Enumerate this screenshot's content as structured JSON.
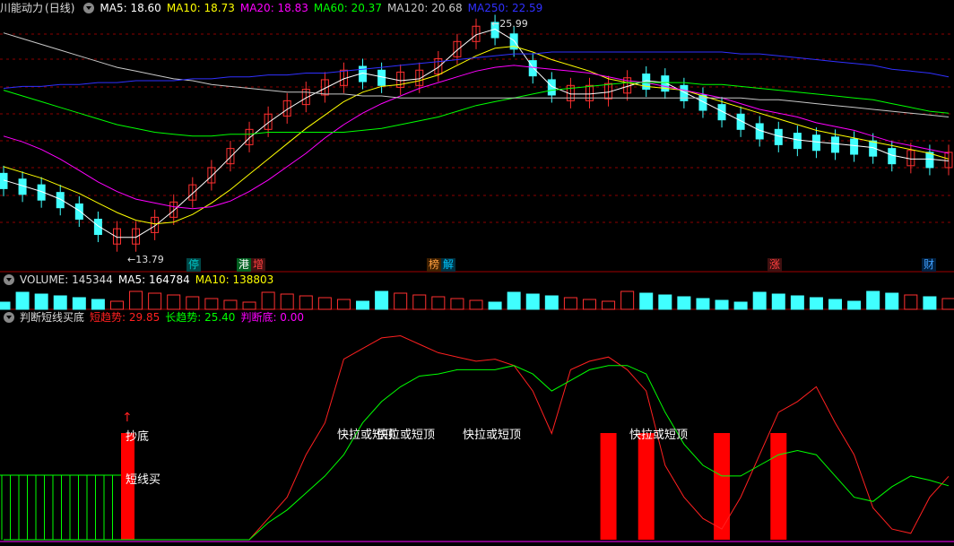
{
  "title": "川能动力",
  "period": "(日线)",
  "ma_header": [
    {
      "label": "MA5: 18.60",
      "color": "#ffffff"
    },
    {
      "label": "MA10: 18.73",
      "color": "#ffff00"
    },
    {
      "label": "MA20: 18.83",
      "color": "#ff00ff"
    },
    {
      "label": "MA60: 20.37",
      "color": "#00ff00"
    },
    {
      "label": "MA120: 20.68",
      "color": "#c8c8c8"
    },
    {
      "label": "MA250: 22.59",
      "color": "#3030ff"
    }
  ],
  "price_high_label": "25.99",
  "price_low_label": "13.79",
  "event_tags": [
    {
      "text": "停",
      "color": "#00c8c8",
      "bg": "#004848"
    },
    {
      "text": "港",
      "color": "#ffffff",
      "bg": "#006020"
    },
    {
      "text": "增",
      "color": "#ff4040",
      "bg": "#401010"
    },
    {
      "text": "榜",
      "color": "#ffa040",
      "bg": "#402000"
    },
    {
      "text": "解",
      "color": "#00c8ff",
      "bg": "#003040"
    },
    {
      "text": "涨",
      "color": "#ff4040",
      "bg": "#401010"
    },
    {
      "text": "财",
      "color": "#40a0ff",
      "bg": "#002040"
    }
  ],
  "volume_header": [
    {
      "label": "VOLUME: 145344",
      "color": "#dddddd"
    },
    {
      "label": "MA5: 164784",
      "color": "#ffffff"
    },
    {
      "label": "MA10: 138803",
      "color": "#ffff00"
    }
  ],
  "indicator_header": [
    {
      "label": "判断短线买底",
      "color": "#dddddd"
    },
    {
      "label": "短趋势: 29.85",
      "color": "#ff2020"
    },
    {
      "label": "长趋势: 25.40",
      "color": "#00ff00"
    },
    {
      "label": "判断底: 0.00",
      "color": "#ff00ff"
    }
  ],
  "indicator_annotations": [
    {
      "text": "抄底"
    },
    {
      "text": "短线买"
    },
    {
      "text": "快拉或短顶"
    },
    {
      "text": "快拉或短顶"
    },
    {
      "text": "快拉或短顶"
    },
    {
      "text": "快拉或短顶"
    }
  ],
  "colors": {
    "up": "#ff3030",
    "down": "#40ffff",
    "grid": "#8b0000"
  },
  "chart_data": {
    "type": "candlestick",
    "price_range": [
      13.79,
      25.99
    ],
    "ma_lines": [
      {
        "name": "MA5",
        "color": "#ffffff",
        "values": [
          17.6,
          17.3,
          17.0,
          16.6,
          16.0,
          15.2,
          14.6,
          14.6,
          15.2,
          16.0,
          16.9,
          17.8,
          18.8,
          19.8,
          20.6,
          21.3,
          21.9,
          22.4,
          22.9,
          23.2,
          23.0,
          22.8,
          22.9,
          23.5,
          24.4,
          25.2,
          25.5,
          24.9,
          23.5,
          22.5,
          22.1,
          22.1,
          22.2,
          22.5,
          22.8,
          22.7,
          22.2,
          21.7,
          21.2,
          20.7,
          20.2,
          19.9,
          19.7,
          19.6,
          19.5,
          19.4,
          19.3,
          18.9,
          18.7,
          18.7,
          18.6
        ]
      },
      {
        "name": "MA10",
        "color": "#ffff00",
        "values": [
          18.3,
          18.0,
          17.7,
          17.3,
          16.9,
          16.4,
          15.9,
          15.5,
          15.3,
          15.4,
          15.8,
          16.4,
          17.1,
          17.9,
          18.7,
          19.5,
          20.3,
          21.0,
          21.7,
          22.2,
          22.5,
          22.6,
          22.8,
          23.1,
          23.6,
          24.1,
          24.5,
          24.6,
          24.3,
          23.9,
          23.6,
          23.3,
          22.9,
          22.7,
          22.5,
          22.4,
          22.3,
          22.0,
          21.7,
          21.4,
          21.1,
          20.8,
          20.5,
          20.2,
          20.0,
          19.8,
          19.6,
          19.4,
          19.2,
          19.0,
          18.7
        ]
      },
      {
        "name": "MA20",
        "color": "#ff00ff",
        "values": [
          19.9,
          19.6,
          19.2,
          18.7,
          18.1,
          17.5,
          17.0,
          16.6,
          16.4,
          16.2,
          16.1,
          16.2,
          16.5,
          17.0,
          17.6,
          18.3,
          19.0,
          19.8,
          20.5,
          21.1,
          21.6,
          22.0,
          22.4,
          22.7,
          23.0,
          23.3,
          23.5,
          23.6,
          23.5,
          23.4,
          23.3,
          23.2,
          23.0,
          22.8,
          22.7,
          22.5,
          22.3,
          22.1,
          21.9,
          21.6,
          21.3,
          21.1,
          20.9,
          20.6,
          20.4,
          20.2,
          19.9,
          19.6,
          19.4,
          19.2,
          19.0
        ]
      },
      {
        "name": "MA60",
        "color": "#00ff00",
        "values": [
          22.3,
          22.0,
          21.7,
          21.4,
          21.1,
          20.8,
          20.5,
          20.3,
          20.1,
          20.0,
          19.9,
          19.9,
          20.0,
          20.0,
          20.1,
          20.1,
          20.1,
          20.1,
          20.1,
          20.2,
          20.3,
          20.5,
          20.7,
          20.9,
          21.2,
          21.5,
          21.7,
          21.9,
          22.1,
          22.3,
          22.4,
          22.5,
          22.6,
          22.7,
          22.7,
          22.7,
          22.7,
          22.6,
          22.6,
          22.5,
          22.4,
          22.3,
          22.2,
          22.1,
          22.0,
          21.9,
          21.8,
          21.6,
          21.4,
          21.2,
          21.1
        ]
      },
      {
        "name": "MA120",
        "color": "#c8c8c8",
        "values": [
          25.3,
          25.0,
          24.7,
          24.4,
          24.1,
          23.8,
          23.5,
          23.3,
          23.1,
          22.9,
          22.8,
          22.6,
          22.5,
          22.4,
          22.3,
          22.2,
          22.2,
          22.1,
          22.1,
          22.0,
          22.0,
          21.9,
          21.9,
          21.9,
          21.9,
          21.9,
          21.9,
          21.9,
          21.9,
          21.9,
          21.9,
          21.9,
          21.9,
          21.9,
          21.9,
          21.9,
          21.9,
          21.9,
          21.9,
          21.9,
          21.8,
          21.8,
          21.7,
          21.6,
          21.5,
          21.4,
          21.3,
          21.2,
          21.1,
          21.0,
          20.9
        ]
      },
      {
        "name": "MA250",
        "color": "#3030ff",
        "values": [
          22.4,
          22.5,
          22.5,
          22.6,
          22.6,
          22.7,
          22.7,
          22.8,
          22.8,
          22.8,
          22.9,
          22.9,
          23.0,
          23.0,
          23.1,
          23.1,
          23.2,
          23.2,
          23.3,
          23.4,
          23.5,
          23.6,
          23.7,
          23.8,
          23.9,
          24.0,
          24.1,
          24.2,
          24.2,
          24.3,
          24.3,
          24.3,
          24.3,
          24.3,
          24.3,
          24.3,
          24.3,
          24.3,
          24.3,
          24.2,
          24.2,
          24.1,
          24.0,
          23.9,
          23.8,
          23.7,
          23.6,
          23.4,
          23.3,
          23.2,
          23.0
        ]
      }
    ],
    "indicator": {
      "short_trend": [
        0,
        0,
        0,
        0,
        0,
        0,
        0,
        0,
        0,
        0,
        0,
        0,
        0,
        0,
        10,
        20,
        40,
        55,
        85,
        90,
        95,
        96,
        92,
        88,
        86,
        84,
        85,
        82,
        70,
        50,
        80,
        84,
        86,
        80,
        70,
        35,
        20,
        10,
        5,
        20,
        40,
        60,
        65,
        72,
        55,
        40,
        15,
        5,
        3,
        20,
        29.85
      ],
      "long_trend": [
        0,
        0,
        0,
        0,
        0,
        0,
        0,
        0,
        0,
        0,
        0,
        0,
        0,
        0,
        8,
        14,
        22,
        30,
        40,
        55,
        65,
        72,
        77,
        78,
        80,
        80,
        80,
        82,
        78,
        70,
        75,
        80,
        82,
        82,
        78,
        60,
        45,
        35,
        30,
        30,
        35,
        40,
        42,
        40,
        30,
        20,
        18,
        25,
        30,
        28,
        25.4
      ],
      "buy_bars_index": [
        32,
        34,
        38,
        41
      ]
    }
  }
}
